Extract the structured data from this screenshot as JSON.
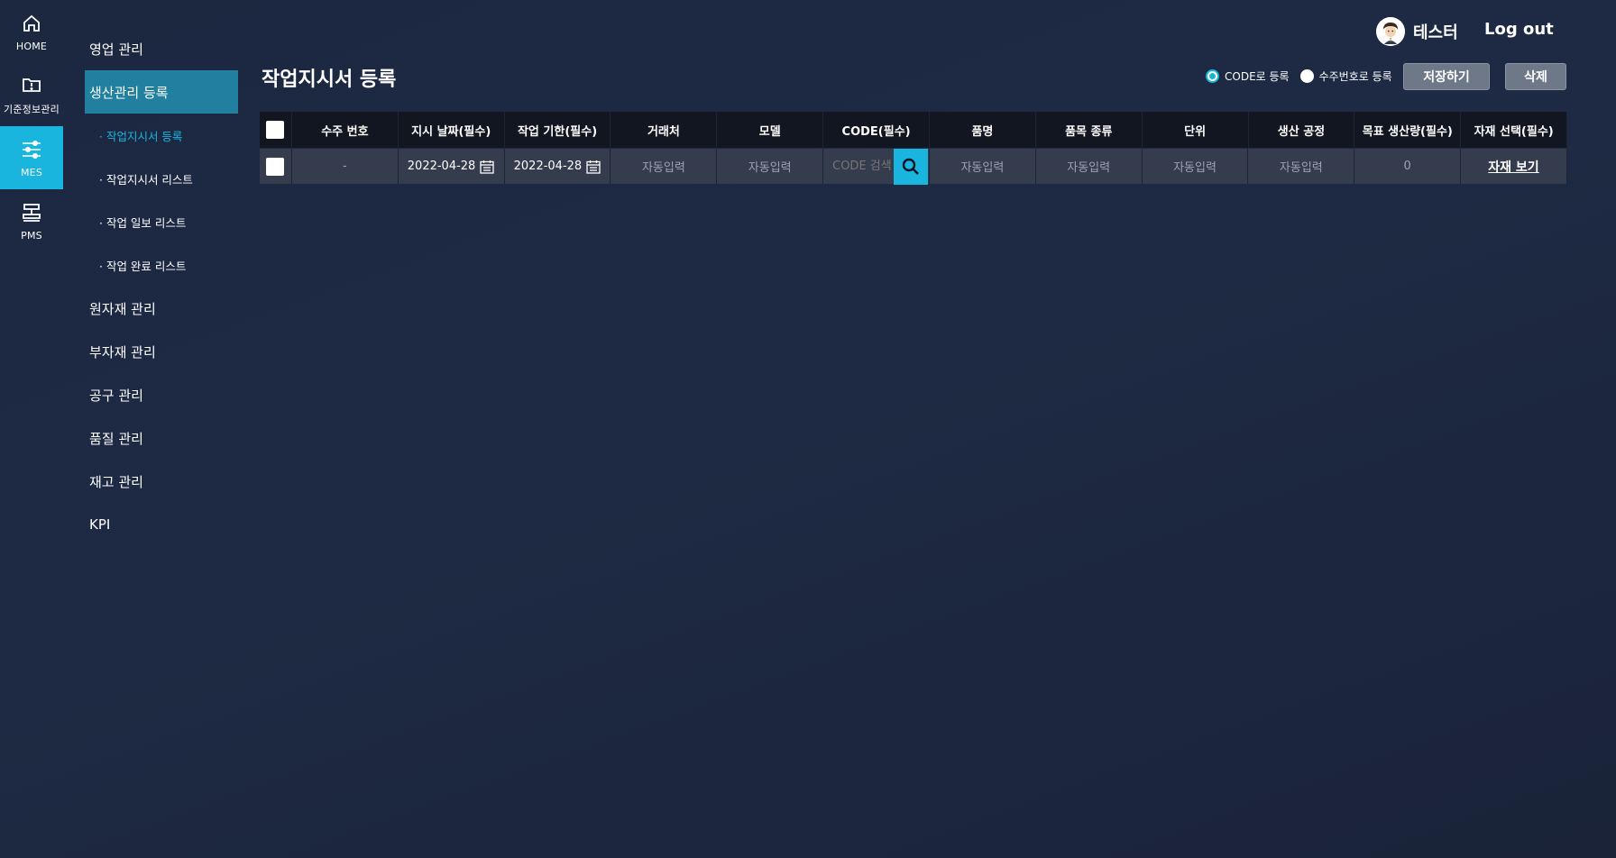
{
  "rail": [
    {
      "label": "HOME",
      "icon": "home-icon",
      "active": false
    },
    {
      "label": "기준정보관리",
      "icon": "info-folder-icon",
      "active": false
    },
    {
      "label": "MES",
      "icon": "sliders-icon",
      "active": true
    },
    {
      "label": "PMS",
      "icon": "machine-icon",
      "active": false
    }
  ],
  "submenu": [
    {
      "label": "영업 관리",
      "type": "main",
      "active": false
    },
    {
      "label": "생산관리 등록",
      "type": "main",
      "active": true
    },
    {
      "label": "· 작업지시서 등록",
      "type": "sub",
      "active": true
    },
    {
      "label": "· 작업지시서 리스트",
      "type": "sub",
      "active": false
    },
    {
      "label": "· 작업 일보 리스트",
      "type": "sub",
      "active": false
    },
    {
      "label": "· 작업 완료 리스트",
      "type": "sub",
      "active": false
    },
    {
      "label": "원자재 관리",
      "type": "main",
      "active": false
    },
    {
      "label": "부자재 관리",
      "type": "main",
      "active": false
    },
    {
      "label": "공구 관리",
      "type": "main",
      "active": false
    },
    {
      "label": "품질 관리",
      "type": "main",
      "active": false
    },
    {
      "label": "재고 관리",
      "type": "main",
      "active": false
    },
    {
      "label": "KPI",
      "type": "main",
      "active": false
    }
  ],
  "header": {
    "user_name": "테스터",
    "logout_label": "Log out"
  },
  "page": {
    "title": "작업지시서 등록",
    "radio_code_label": "CODE로 등록",
    "radio_order_label": "수주번호로 등록",
    "radio_selected": "code",
    "save_label": "저장하기",
    "delete_label": "삭제"
  },
  "table": {
    "columns": [
      "수주 번호",
      "지시 날짜(필수)",
      "작업 기한(필수)",
      "거래처",
      "모델",
      "CODE(필수)",
      "품명",
      "품목 종류",
      "단위",
      "생산 공정",
      "목표 생산량(필수)",
      "자재 선택(필수)"
    ],
    "row": {
      "order_no": "-",
      "instruct_date": "2022-04-28",
      "deadline": "2022-04-28",
      "customer": "자동입력",
      "model": "자동입력",
      "code_placeholder": "CODE 검색",
      "item_name": "자동입력",
      "item_type": "자동입력",
      "unit": "자동입력",
      "process": "자동입력",
      "target_qty": "0",
      "material_link": "자재 보기"
    }
  },
  "colors": {
    "accent": "#19b5de",
    "menu_active": "#21809f"
  }
}
